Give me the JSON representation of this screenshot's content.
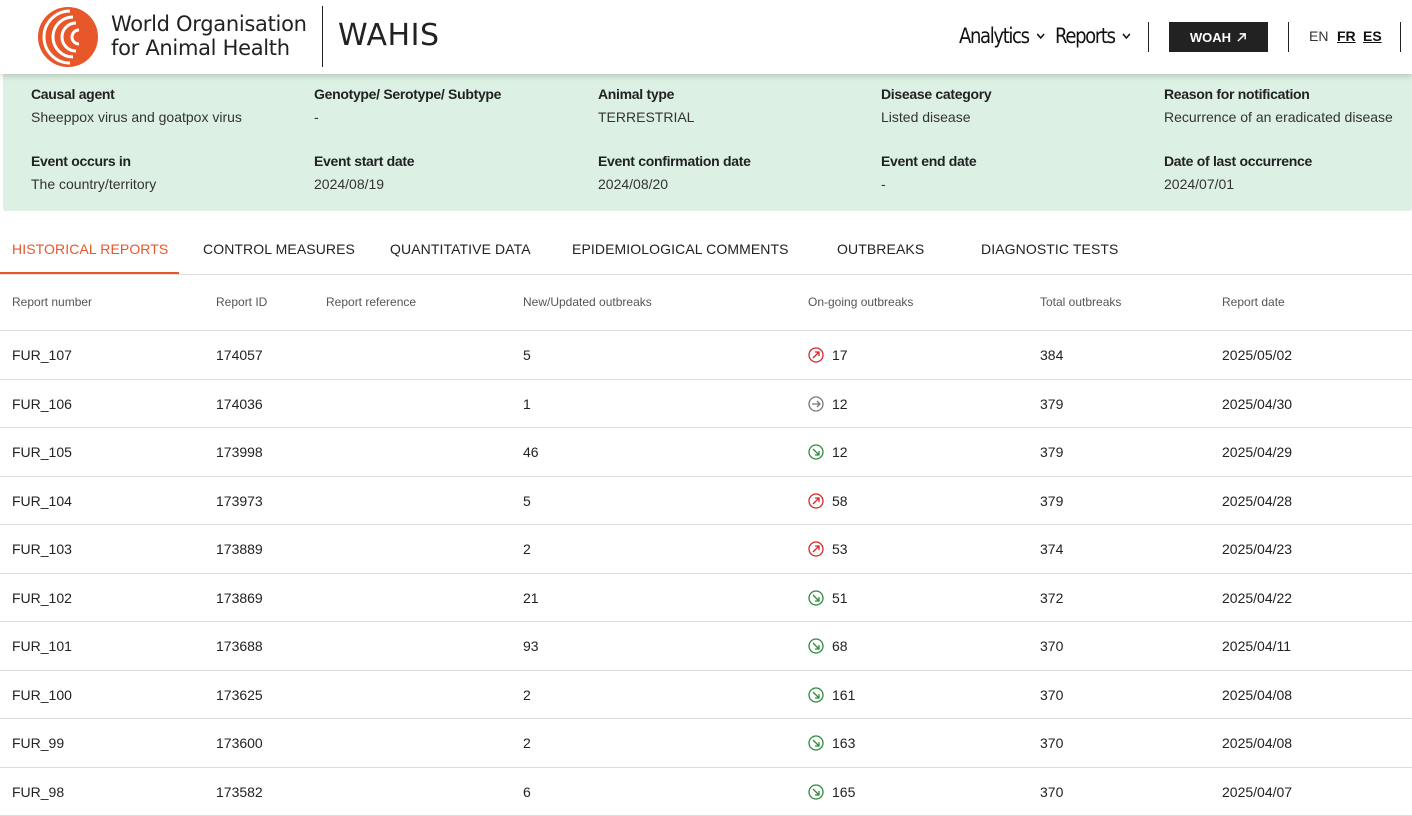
{
  "header": {
    "org_line1": "World Organisation",
    "org_line2": "for Animal Health",
    "app_name": "WAHIS",
    "nav": {
      "analytics": "Analytics",
      "reports": "Reports"
    },
    "woah_button": "WOAH",
    "languages": [
      "EN",
      "FR",
      "ES"
    ],
    "brand_color": "#e8572a"
  },
  "info": {
    "causal_agent": {
      "label": "Causal agent",
      "value": "Sheeppox virus and goatpox virus"
    },
    "genotype": {
      "label": "Genotype/ Serotype/ Subtype",
      "value": "-"
    },
    "animal_type": {
      "label": "Animal type",
      "value": "TERRESTRIAL"
    },
    "disease_category": {
      "label": "Disease category",
      "value": "Listed disease"
    },
    "reason": {
      "label": "Reason for notification",
      "value": "Recurrence of an eradicated disease"
    },
    "event_occurs_in": {
      "label": "Event occurs in",
      "value": "The country/territory"
    },
    "event_start": {
      "label": "Event start date",
      "value": "2024/08/19"
    },
    "event_confirmation": {
      "label": "Event confirmation date",
      "value": "2024/08/20"
    },
    "event_end": {
      "label": "Event end date",
      "value": "-"
    },
    "last_occurrence": {
      "label": "Date of last occurrence",
      "value": "2024/07/01"
    }
  },
  "tabs": [
    "HISTORICAL REPORTS",
    "CONTROL MEASURES",
    "QUANTITATIVE DATA",
    "EPIDEMIOLOGICAL COMMENTS",
    "OUTBREAKS",
    "DIAGNOSTIC TESTS"
  ],
  "table": {
    "headers": [
      "Report number",
      "Report ID",
      "Report reference",
      "New/Updated outbreaks",
      "On-going outbreaks",
      "Total outbreaks",
      "Report date"
    ],
    "trend_colors": {
      "up": "#d9262b",
      "flat": "#777777",
      "down": "#2e8b3e"
    },
    "rows": [
      {
        "number": "FUR_107",
        "id": "174057",
        "reference": "",
        "new": "5",
        "trend": "up",
        "ongoing": "17",
        "total": "384",
        "date": "2025/05/02"
      },
      {
        "number": "FUR_106",
        "id": "174036",
        "reference": "",
        "new": "1",
        "trend": "flat",
        "ongoing": "12",
        "total": "379",
        "date": "2025/04/30"
      },
      {
        "number": "FUR_105",
        "id": "173998",
        "reference": "",
        "new": "46",
        "trend": "down",
        "ongoing": "12",
        "total": "379",
        "date": "2025/04/29"
      },
      {
        "number": "FUR_104",
        "id": "173973",
        "reference": "",
        "new": "5",
        "trend": "up",
        "ongoing": "58",
        "total": "379",
        "date": "2025/04/28"
      },
      {
        "number": "FUR_103",
        "id": "173889",
        "reference": "",
        "new": "2",
        "trend": "up",
        "ongoing": "53",
        "total": "374",
        "date": "2025/04/23"
      },
      {
        "number": "FUR_102",
        "id": "173869",
        "reference": "",
        "new": "21",
        "trend": "down",
        "ongoing": "51",
        "total": "372",
        "date": "2025/04/22"
      },
      {
        "number": "FUR_101",
        "id": "173688",
        "reference": "",
        "new": "93",
        "trend": "down",
        "ongoing": "68",
        "total": "370",
        "date": "2025/04/11"
      },
      {
        "number": "FUR_100",
        "id": "173625",
        "reference": "",
        "new": "2",
        "trend": "down",
        "ongoing": "161",
        "total": "370",
        "date": "2025/04/08"
      },
      {
        "number": "FUR_99",
        "id": "173600",
        "reference": "",
        "new": "2",
        "trend": "down",
        "ongoing": "163",
        "total": "370",
        "date": "2025/04/08"
      },
      {
        "number": "FUR_98",
        "id": "173582",
        "reference": "",
        "new": "6",
        "trend": "down",
        "ongoing": "165",
        "total": "370",
        "date": "2025/04/07"
      }
    ]
  }
}
